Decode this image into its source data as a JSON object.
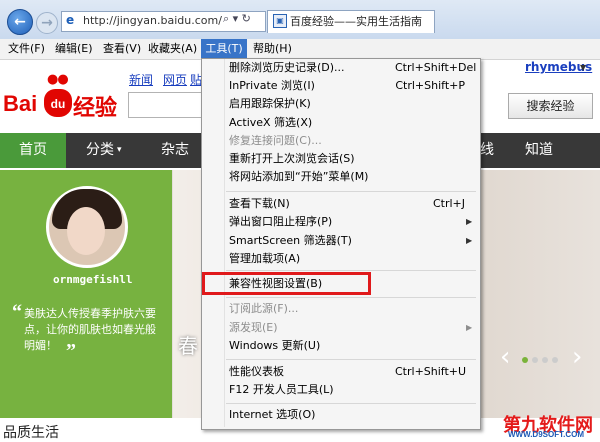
{
  "browser": {
    "address": "http://jingyan.baidu.com/",
    "tab_title": "百度经验——实用生活指南",
    "address_icons": "⌕ ▾ ↻"
  },
  "menubar": [
    "文件(F)",
    "编辑(E)",
    "查看(V)",
    "收藏夹(A)",
    "工具(T)",
    "帮助(H)"
  ],
  "page": {
    "logo_bai": "Bai",
    "logo_du": "du",
    "logo_jingyan": "经验",
    "top_links": [
      "新闻",
      "网页",
      "贴"
    ],
    "user": "rhymebus",
    "search_button": "搜索经验",
    "nav": {
      "home": "首页",
      "category": "分类",
      "magazine": "杂志",
      "right1": "线",
      "right2": "知道"
    },
    "profile_name": "ornmgefishll",
    "quote": "美肤达人传授春季护肤六要点，让你的肌肤也如春光般明媚！",
    "spring_text": "春",
    "bottom_title": "品质生活",
    "watermark": "第九软件网",
    "watermark_sub": "WWW.D9SOFT.COM"
  },
  "tools_menu": {
    "items": [
      {
        "label": "删除浏览历史记录(D)...",
        "shortcut": "Ctrl+Shift+Del"
      },
      {
        "label": "InPrivate 浏览(I)",
        "shortcut": "Ctrl+Shift+P"
      },
      {
        "label": "启用跟踪保护(K)",
        "shortcut": ""
      },
      {
        "label": "ActiveX 筛选(X)",
        "shortcut": ""
      },
      {
        "label": "修复连接问题(C)...",
        "shortcut": "",
        "disabled": true
      },
      {
        "label": "重新打开上次浏览会话(S)",
        "shortcut": ""
      },
      {
        "label": "将网站添加到“开始”菜单(M)",
        "shortcut": ""
      },
      {
        "label": "查看下载(N)",
        "shortcut": "Ctrl+J"
      },
      {
        "label": "弹出窗口阻止程序(P)",
        "shortcut": "",
        "submenu": true
      },
      {
        "label": "SmartScreen 筛选器(T)",
        "shortcut": "",
        "submenu": true
      },
      {
        "label": "管理加载项(A)",
        "shortcut": ""
      },
      {
        "label": "兼容性视图设置(B)",
        "shortcut": ""
      },
      {
        "label": "订阅此源(F)...",
        "shortcut": "",
        "disabled": true
      },
      {
        "label": "源发现(E)",
        "shortcut": "",
        "disabled": true,
        "submenu": true
      },
      {
        "label": "Windows 更新(U)",
        "shortcut": ""
      },
      {
        "label": "性能仪表板",
        "shortcut": "Ctrl+Shift+U"
      },
      {
        "label": "F12 开发人员工具(L)",
        "shortcut": ""
      },
      {
        "label": "Internet 选项(O)",
        "shortcut": ""
      }
    ]
  },
  "colors": {
    "highlight_box": "#e0191b",
    "menu_active": "#3874c8",
    "nav_active": "#4a9a3a",
    "brand": "#e10602"
  }
}
